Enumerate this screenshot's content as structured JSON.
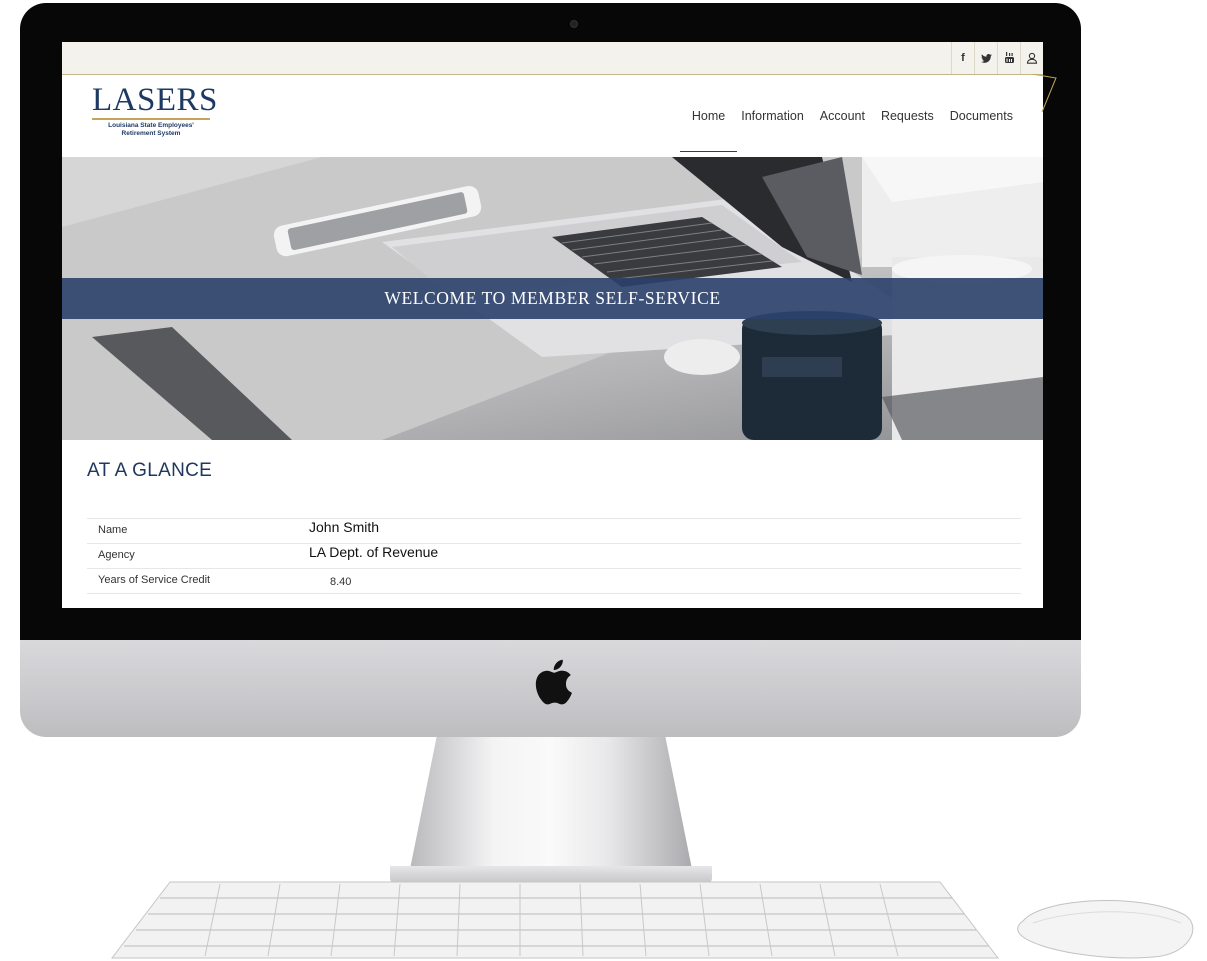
{
  "site": {
    "logo_text": "LASERS",
    "logo_subtitle_line1": "Louisiana State Employees'",
    "logo_subtitle_line2": "Retirement System"
  },
  "topbar": {
    "social": [
      {
        "icon": "facebook-icon",
        "glyph": "f"
      },
      {
        "icon": "twitter-icon"
      },
      {
        "icon": "youtube-icon"
      },
      {
        "icon": "user-icon"
      }
    ]
  },
  "nav": {
    "items": [
      {
        "label": "Home",
        "active": true
      },
      {
        "label": "Information"
      },
      {
        "label": "Account"
      },
      {
        "label": "Requests"
      },
      {
        "label": "Documents"
      }
    ]
  },
  "hero": {
    "banner_text": "WELCOME TO MEMBER SELF-SERVICE"
  },
  "glance": {
    "title": "AT A GLANCE",
    "rows": [
      {
        "label": "Name",
        "value": "John Smith"
      },
      {
        "label": "Agency",
        "value": "LA Dept. of Revenue"
      },
      {
        "label": "Years of Service Credit",
        "value": "8.40"
      }
    ]
  },
  "colors": {
    "brand_navy": "#1e3a63",
    "banner": "#2b416b",
    "accent_gold": "#c3a45a"
  }
}
